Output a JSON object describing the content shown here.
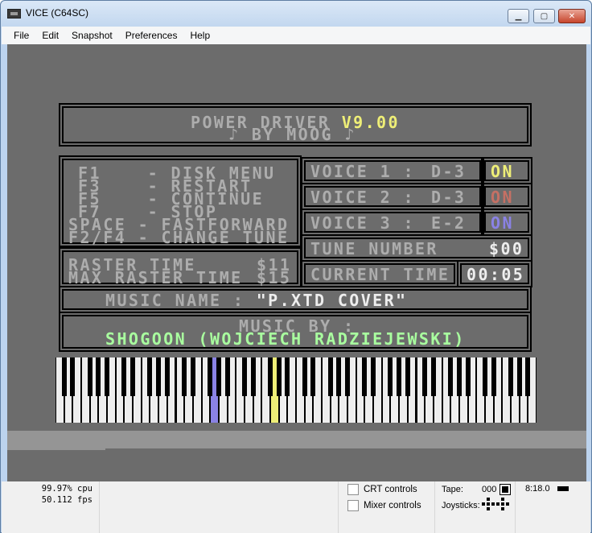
{
  "window": {
    "title": "VICE (C64SC)",
    "controls": {
      "minimize": "▁",
      "maximize": "▢",
      "close": "✕"
    }
  },
  "menu": [
    "File",
    "Edit",
    "Snapshot",
    "Preferences",
    "Help"
  ],
  "screen": {
    "header": {
      "title": "POWER DRIVER ",
      "version": "V9.00",
      "byline": "♪ BY MOOG ♪"
    },
    "keys": [
      "F1    - DISK MENU",
      "F3    - RESTART",
      "F5    - CONTINUE",
      "F7    - STOP",
      "SPACE - FASTFORWARD",
      "F2/F4 - CHANGE TUNE"
    ],
    "raster": {
      "label": "RASTER TIME",
      "value": "$11",
      "max_label": "MAX RASTER TIME",
      "max_value": "$15"
    },
    "voices": [
      {
        "label": "VOICE 1 :",
        "note": "D-3",
        "state": "ON",
        "state_color": "#eeee77"
      },
      {
        "label": "VOICE 2 :",
        "note": "D-3",
        "state": "ON",
        "state_color": "#c57064"
      },
      {
        "label": "VOICE 3 :",
        "note": "E-2",
        "state": "ON",
        "state_color": "#8a82e5"
      }
    ],
    "tune": {
      "label": "TUNE NUMBER",
      "value": "$00"
    },
    "current_time": {
      "label": "CURRENT TIME",
      "value": "00:05"
    },
    "music_name": {
      "label": "MUSIC NAME : ",
      "value": "\"P.XTD COVER\""
    },
    "music_by": {
      "label": "MUSIC BY :",
      "value": "SHOGOON (WOJCIECH RADZIEJEWSKI)"
    },
    "colors": {
      "text": "#adadad",
      "highlight": "#eeee77",
      "white": "#eeeeee",
      "green": "#a9ff9f",
      "key_voice3": "#8a82e5",
      "key_voice1": "#eeee77"
    }
  },
  "keyboard": {
    "white_key_count": 56,
    "active_white_keys": [
      {
        "index": 18,
        "color": "#8a82e5"
      },
      {
        "index": 25,
        "color": "#eeee77"
      }
    ]
  },
  "status": {
    "cpu": "99.97% cpu",
    "fps": "50.112 fps",
    "crt_controls": "CRT controls",
    "mixer_controls": "Mixer controls",
    "tape_label": "Tape:",
    "tape_counter": "000",
    "joysticks_label": "Joysticks:",
    "clock": "8:18.0"
  }
}
